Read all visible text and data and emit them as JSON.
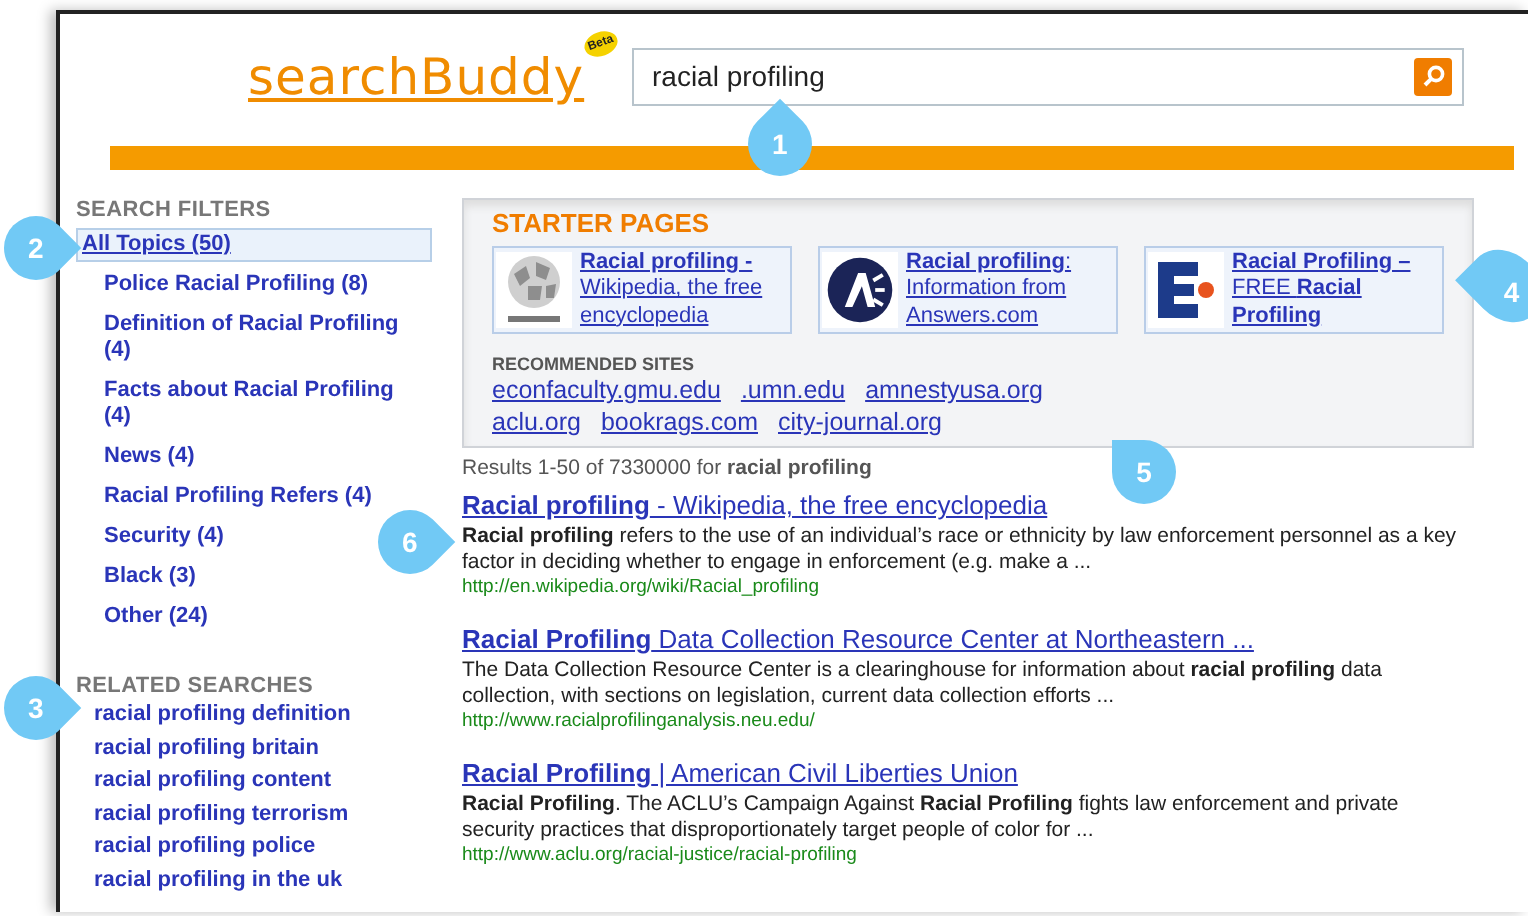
{
  "header": {
    "logo": "searchBuddy",
    "logo_badge": "Beta",
    "search": {
      "value": "racial profiling"
    }
  },
  "search_filters": {
    "title": "SEARCH FILTERS",
    "items": [
      {
        "label": "All Topics (50)",
        "selected": true,
        "children": [
          {
            "label": "Police Racial Profiling (8)",
            "selected": false
          },
          {
            "label": "Definition of Racial Profiling (4)",
            "selected": false
          },
          {
            "label": "Facts about Racial Profiling (4)",
            "selected": false
          },
          {
            "label": "News (4)",
            "selected": false
          },
          {
            "label": "Racial Profiling Refers (4)",
            "selected": false
          },
          {
            "label": "Security (4)",
            "selected": false
          },
          {
            "label": "Black (3)",
            "selected": false
          },
          {
            "label": "Other (24)",
            "selected": false
          }
        ]
      }
    ]
  },
  "related_searches": {
    "title": "RELATED SEARCHES",
    "items": [
      "racial profiling definition",
      "racial profiling britain",
      "racial profiling content",
      "racial profiling terrorism",
      "racial profiling police",
      "racial profiling in the uk"
    ]
  },
  "starter_pages": {
    "title": "STARTER PAGES",
    "items": [
      {
        "kind": "globe",
        "title": "**Racial profiling -** Wikipedia, the free encyclopedia"
      },
      {
        "kind": "answers",
        "title": "**Racial profiling**: Information from Answers.com"
      },
      {
        "kind": "letter",
        "title": "**Racial Profiling –** FREE **Racial Profiling**"
      }
    ],
    "recommended_title": "RECOMMENDED SITES",
    "recommended_sites": [
      [
        "econfaculty.gmu.edu",
        ".umn.edu",
        "amnestyusa.org"
      ],
      [
        "aclu.org",
        "bookrags.com",
        "city-journal.org"
      ]
    ]
  },
  "results_summary": "Results 1-50 of 7330000 for **racial profiling**",
  "results": [
    {
      "title": "**Racial profiling** - Wikipedia, the free encyclopedia",
      "snippet": "**Racial profiling** refers to the use of an individual’s race or ethnicity by law enforcement personnel as a key factor in deciding whether to engage in enforcement (e.g. make a ...",
      "url": "http://en.wikipedia.org/wiki/Racial_profiling"
    },
    {
      "title": "**Racial Profiling** Data Collection Resource Center at Northeastern ...",
      "snippet": "The Data Collection Resource Center is a clearinghouse for information about **racial profiling** data collection, with sections on legislation, current data collection efforts ...",
      "url": "http://www.racialprofilinganalysis.neu.edu/"
    },
    {
      "title": "**Racial Profiling** | American Civil Liberties Union",
      "snippet": "**Racial Profiling**. The ACLU’s Campaign Against **Racial Profiling** fights law enforcement and private security practices that disproportionately target people of color for ...",
      "url": "http://www.aclu.org/racial-justice/racial-profiling"
    }
  ],
  "callouts": [
    {
      "label": "1"
    },
    {
      "label": "2"
    },
    {
      "label": "3"
    },
    {
      "label": "4"
    },
    {
      "label": "5"
    },
    {
      "label": "6"
    }
  ]
}
